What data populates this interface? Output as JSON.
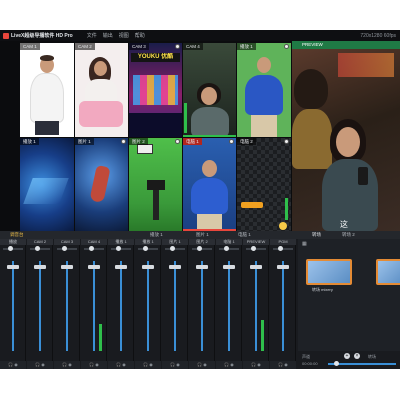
{
  "titlebar": {
    "app_title": "LiveX超级导播软件 HD Pro",
    "menus": [
      "文件",
      "输出",
      "视图",
      "帮助"
    ],
    "resolution": "720x1280 60fps"
  },
  "tiles": [
    {
      "label": "CAM 1"
    },
    {
      "label": "CAM 2"
    },
    {
      "label": "CAM 3",
      "logo_text": "YOUKU 优酷"
    },
    {
      "label": "CAM 4"
    },
    {
      "label": "播放 1"
    },
    {
      "label": "播放 1"
    },
    {
      "label": "图片 1"
    },
    {
      "label": "图片 2"
    },
    {
      "label": "电脑 1"
    },
    {
      "label": "电脑 2"
    }
  ],
  "program": {
    "label": "PREVIEW",
    "subtitle": "这"
  },
  "sections": {
    "mixer": "调音台",
    "mid_a": "播放 1",
    "mid_b": "图片 1",
    "mid_c": "电脑 1",
    "transitions": "转场",
    "transitions2": "转场 2"
  },
  "mixer": {
    "strips": [
      {
        "name": "播放",
        "level": 0.0
      },
      {
        "name": "CAM 2",
        "level": 0.0
      },
      {
        "name": "CAM 3",
        "level": 0.0
      },
      {
        "name": "CAM 4",
        "level": 0.3
      },
      {
        "name": "播放 1",
        "level": 0.0
      },
      {
        "name": "播放 1",
        "level": 0.0
      },
      {
        "name": "图片 1",
        "level": 0.0
      },
      {
        "name": "图片 2",
        "level": 0.0
      },
      {
        "name": "电脑 1",
        "level": 0.0
      },
      {
        "name": "PREVIEW",
        "level": 0.35
      },
      {
        "name": "PGM",
        "level": 0.0
      }
    ]
  },
  "transitions": {
    "thumbs": [
      {
        "label": "转场 mixery"
      }
    ],
    "footer_label": "声道",
    "footer_right": "转场",
    "time": "00:00:00"
  },
  "colors": {
    "accent": "#f0c048",
    "tally_red": "#e8463c",
    "tally_green": "#2fbf4b",
    "fader": "#3a8fd6"
  }
}
